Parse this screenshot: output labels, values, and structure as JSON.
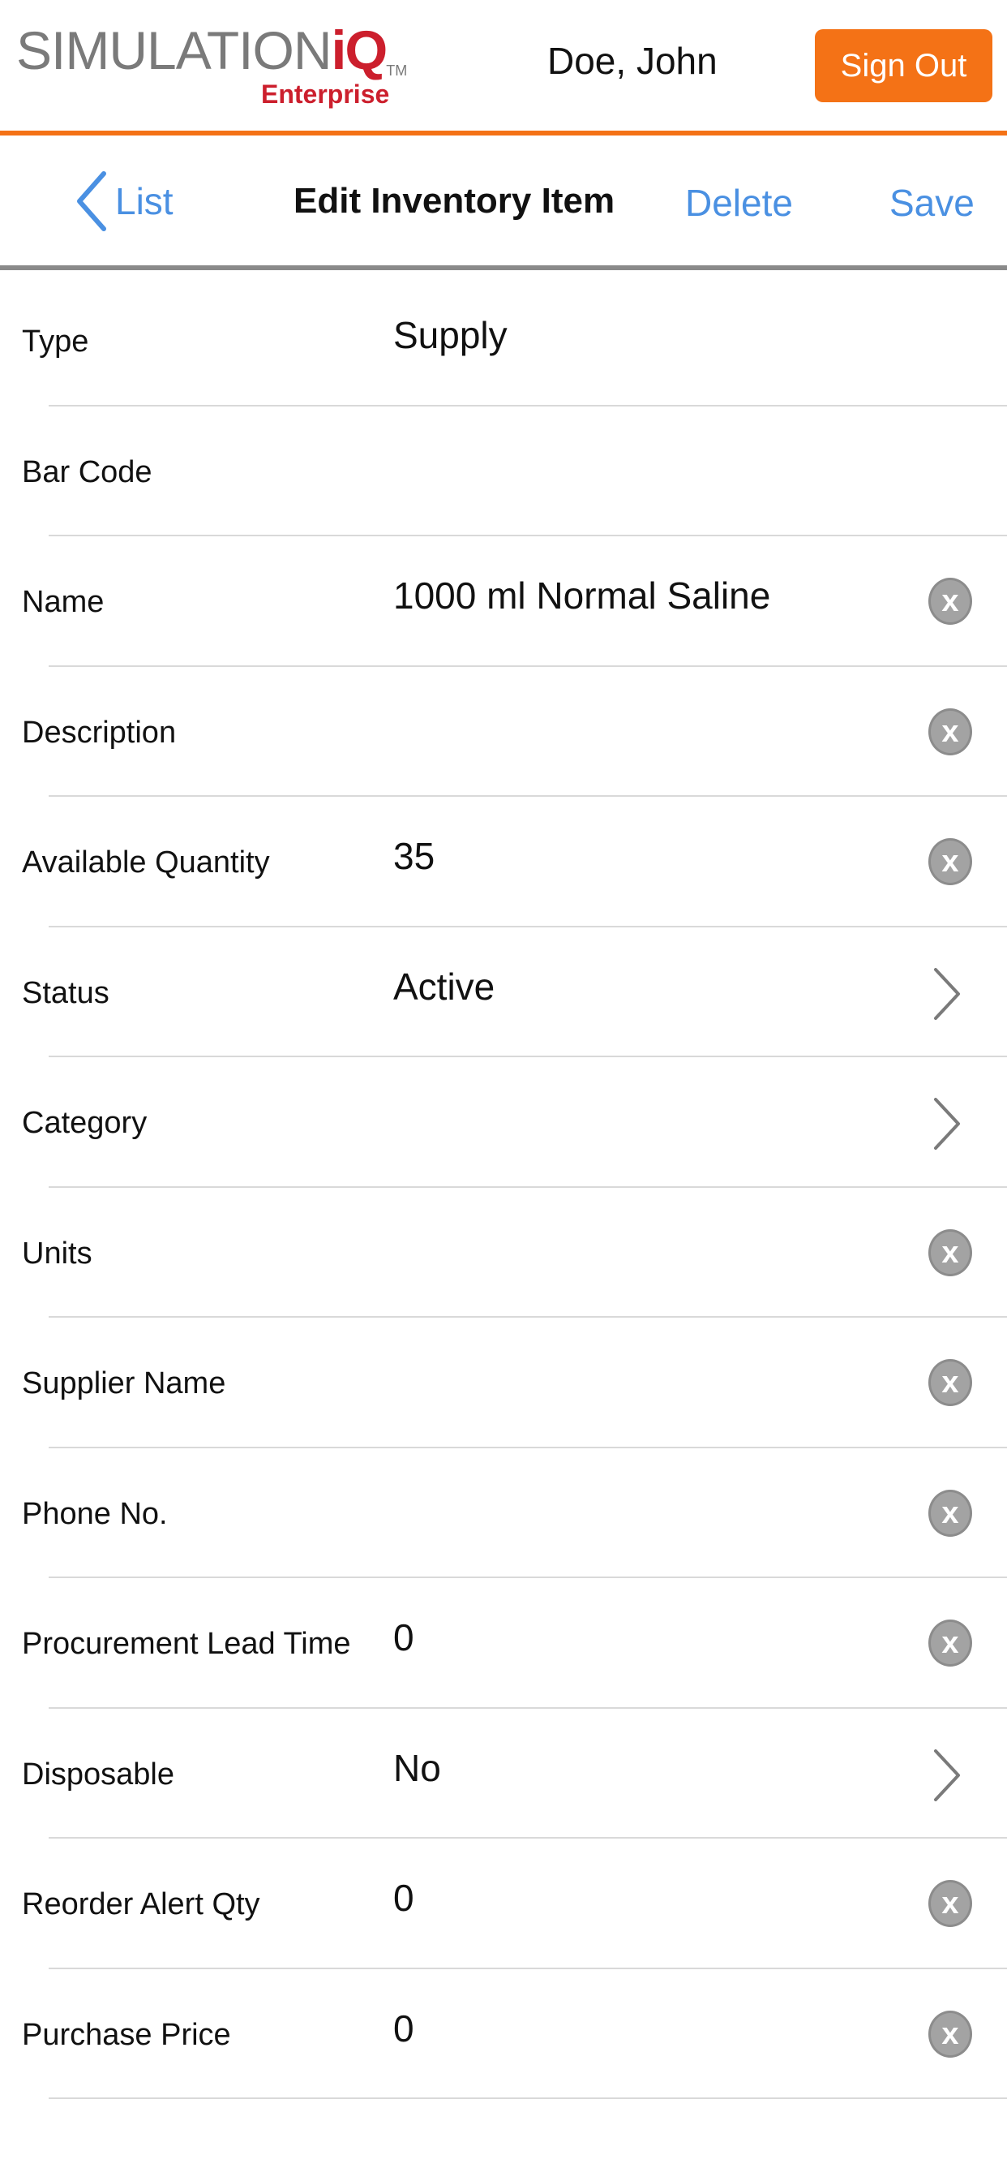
{
  "header": {
    "logo_word": "SIMULATION",
    "logo_iq": "iQ",
    "logo_tm": "TM",
    "logo_sub": "Enterprise",
    "user_name": "Doe, John",
    "sign_out_label": "Sign Out"
  },
  "nav": {
    "back_label": "List",
    "title": "Edit Inventory Item",
    "delete_label": "Delete",
    "save_label": "Save"
  },
  "colors": {
    "accent_orange": "#f47216",
    "link_blue": "#4a90e2",
    "brand_red": "#cc1f2d"
  },
  "form": {
    "rows": [
      {
        "label": "Type",
        "value": "Supply",
        "accessory": "none"
      },
      {
        "label": "Bar Code",
        "value": "",
        "accessory": "none"
      },
      {
        "label": "Name",
        "value": "1000 ml Normal Saline",
        "accessory": "clear-icon"
      },
      {
        "label": "Description",
        "value": "",
        "accessory": "clear-icon"
      },
      {
        "label": "Available Quantity",
        "value": "35",
        "accessory": "clear-icon"
      },
      {
        "label": "Status",
        "value": "Active",
        "accessory": "chevron-right-icon"
      },
      {
        "label": "Category",
        "value": "",
        "accessory": "chevron-right-icon"
      },
      {
        "label": "Units",
        "value": "",
        "accessory": "clear-icon"
      },
      {
        "label": "Supplier Name",
        "value": "",
        "accessory": "clear-icon"
      },
      {
        "label": "Phone No.",
        "value": "",
        "accessory": "clear-icon"
      },
      {
        "label": "Procurement Lead Time",
        "value": "0",
        "accessory": "clear-icon"
      },
      {
        "label": "Disposable",
        "value": "No",
        "accessory": "chevron-right-icon"
      },
      {
        "label": "Reorder Alert Qty",
        "value": "0",
        "accessory": "clear-icon"
      },
      {
        "label": "Purchase Price",
        "value": "0",
        "accessory": "clear-icon"
      }
    ],
    "clear_glyph": "x"
  }
}
